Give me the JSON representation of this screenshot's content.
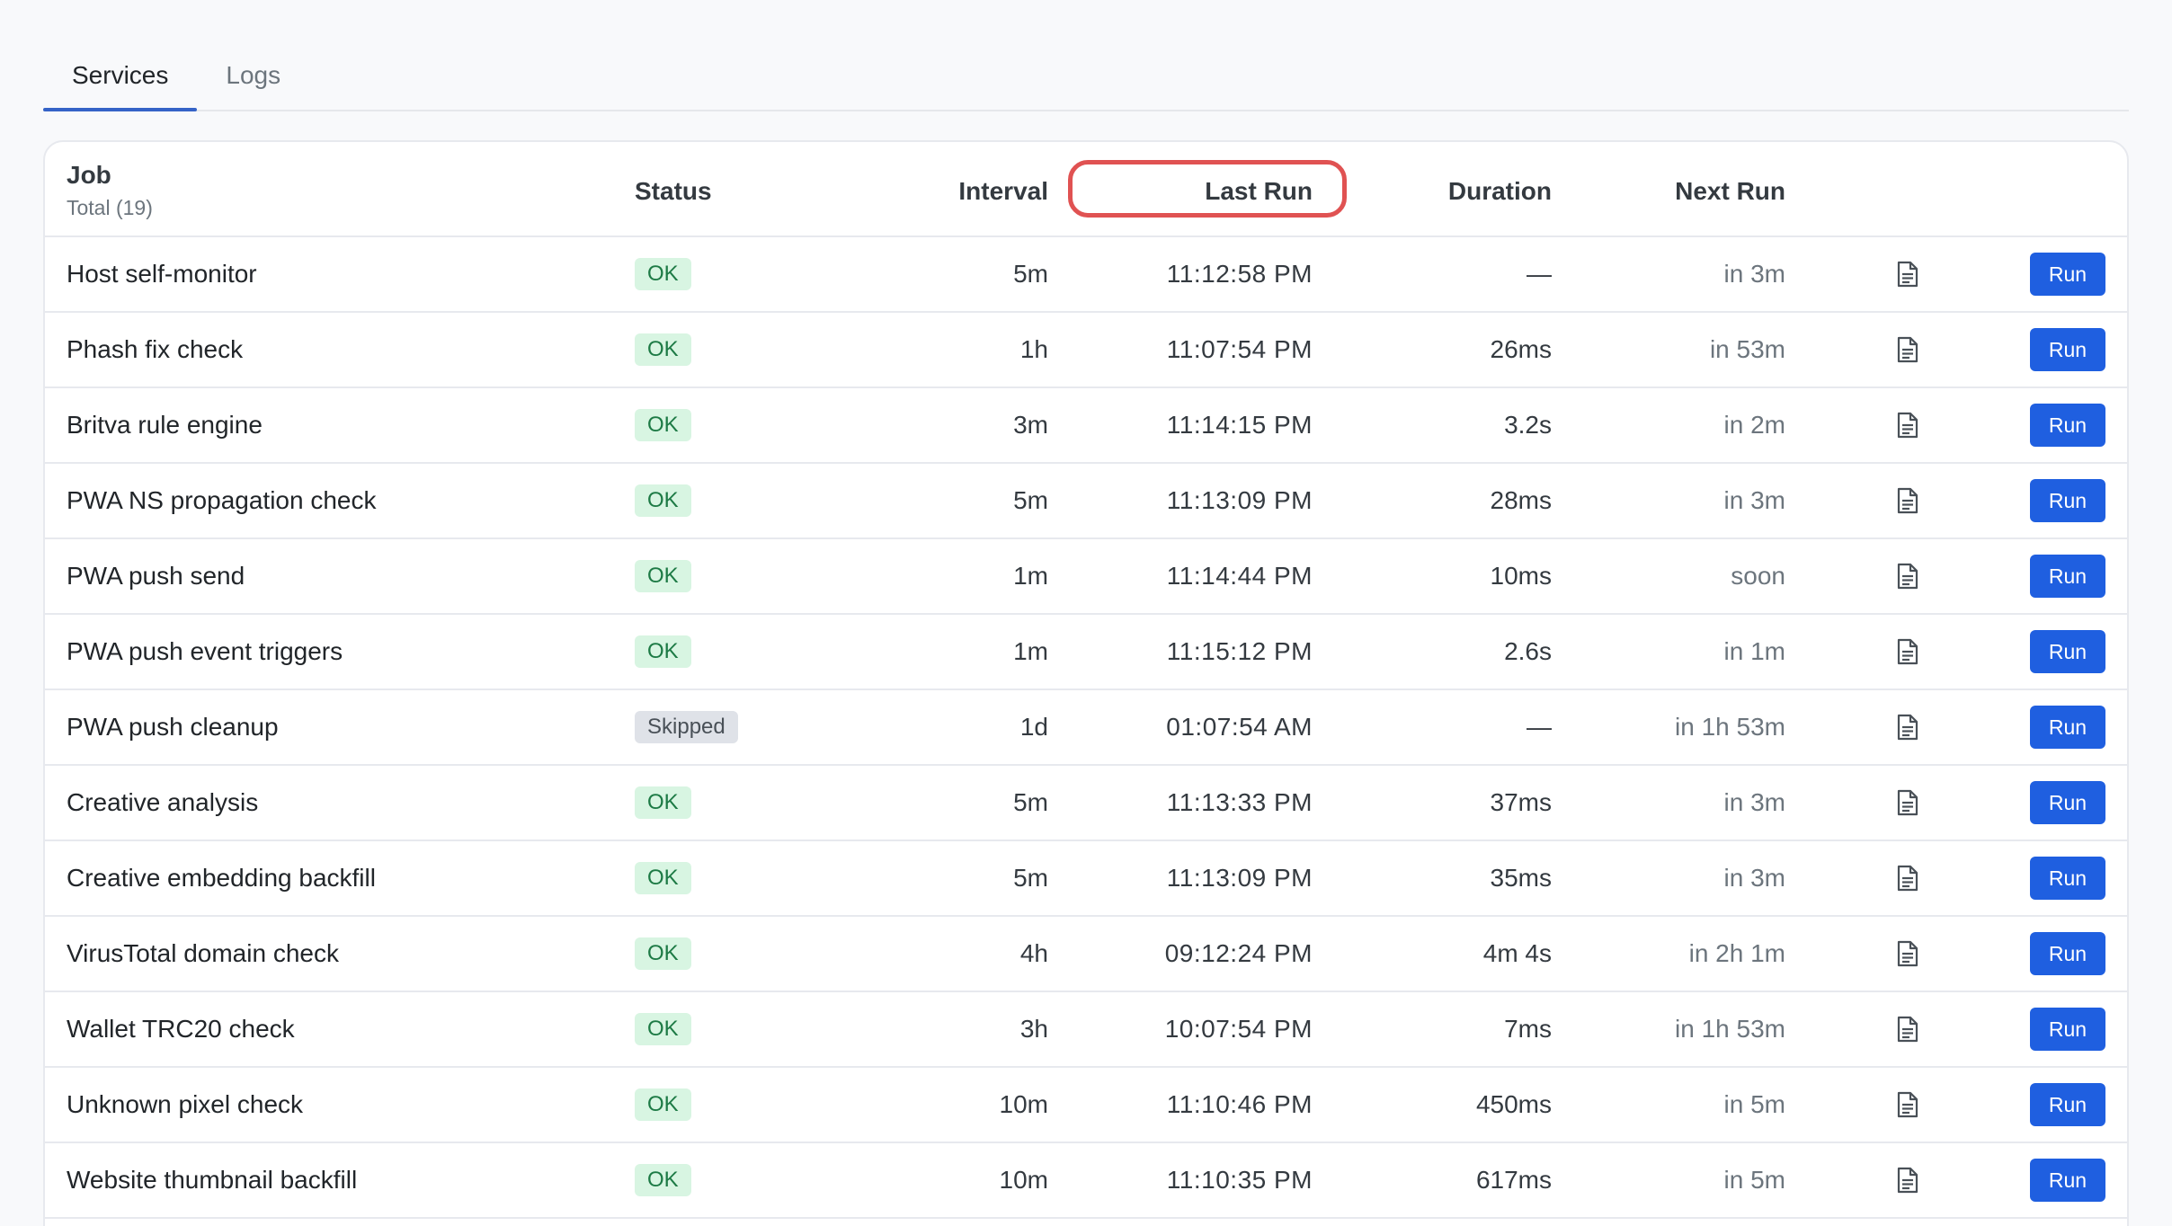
{
  "tabs": [
    {
      "label": "Services",
      "active": true
    },
    {
      "label": "Logs",
      "active": false
    }
  ],
  "table": {
    "headers": {
      "job": "Job",
      "job_total": "Total (19)",
      "status": "Status",
      "interval": "Interval",
      "last_run": "Last Run",
      "duration": "Duration",
      "next_run": "Next Run"
    },
    "run_label": "Run",
    "log_icon": "document-icon",
    "colors": {
      "ok_bg": "#d8f5e2",
      "ok_text": "#1d7a45",
      "skipped_bg": "#dfe2e8",
      "run_button": "#1f5fe0",
      "highlight": "#e05252"
    },
    "rows": [
      {
        "job": "Host self-monitor",
        "status": "OK",
        "status_type": "ok",
        "interval": "5m",
        "last_run": "11:12:58 PM",
        "duration": "—",
        "next_run": "in 3m"
      },
      {
        "job": "Phash fix check",
        "status": "OK",
        "status_type": "ok",
        "interval": "1h",
        "last_run": "11:07:54 PM",
        "duration": "26ms",
        "next_run": "in 53m"
      },
      {
        "job": "Britva rule engine",
        "status": "OK",
        "status_type": "ok",
        "interval": "3m",
        "last_run": "11:14:15 PM",
        "duration": "3.2s",
        "next_run": "in 2m"
      },
      {
        "job": "PWA NS propagation check",
        "status": "OK",
        "status_type": "ok",
        "interval": "5m",
        "last_run": "11:13:09 PM",
        "duration": "28ms",
        "next_run": "in 3m"
      },
      {
        "job": "PWA push send",
        "status": "OK",
        "status_type": "ok",
        "interval": "1m",
        "last_run": "11:14:44 PM",
        "duration": "10ms",
        "next_run": "soon"
      },
      {
        "job": "PWA push event triggers",
        "status": "OK",
        "status_type": "ok",
        "interval": "1m",
        "last_run": "11:15:12 PM",
        "duration": "2.6s",
        "next_run": "in 1m"
      },
      {
        "job": "PWA push cleanup",
        "status": "Skipped",
        "status_type": "skipped",
        "interval": "1d",
        "last_run": "01:07:54 AM",
        "duration": "—",
        "next_run": "in 1h 53m"
      },
      {
        "job": "Creative analysis",
        "status": "OK",
        "status_type": "ok",
        "interval": "5m",
        "last_run": "11:13:33 PM",
        "duration": "37ms",
        "next_run": "in 3m"
      },
      {
        "job": "Creative embedding backfill",
        "status": "OK",
        "status_type": "ok",
        "interval": "5m",
        "last_run": "11:13:09 PM",
        "duration": "35ms",
        "next_run": "in 3m"
      },
      {
        "job": "VirusTotal domain check",
        "status": "OK",
        "status_type": "ok",
        "interval": "4h",
        "last_run": "09:12:24 PM",
        "duration": "4m 4s",
        "next_run": "in 2h 1m"
      },
      {
        "job": "Wallet TRC20 check",
        "status": "OK",
        "status_type": "ok",
        "interval": "3h",
        "last_run": "10:07:54 PM",
        "duration": "7ms",
        "next_run": "in 1h 53m"
      },
      {
        "job": "Unknown pixel check",
        "status": "OK",
        "status_type": "ok",
        "interval": "10m",
        "last_run": "11:10:46 PM",
        "duration": "450ms",
        "next_run": "in 5m"
      },
      {
        "job": "Website thumbnail backfill",
        "status": "OK",
        "status_type": "ok",
        "interval": "10m",
        "last_run": "11:10:35 PM",
        "duration": "617ms",
        "next_run": "in 5m"
      }
    ]
  }
}
